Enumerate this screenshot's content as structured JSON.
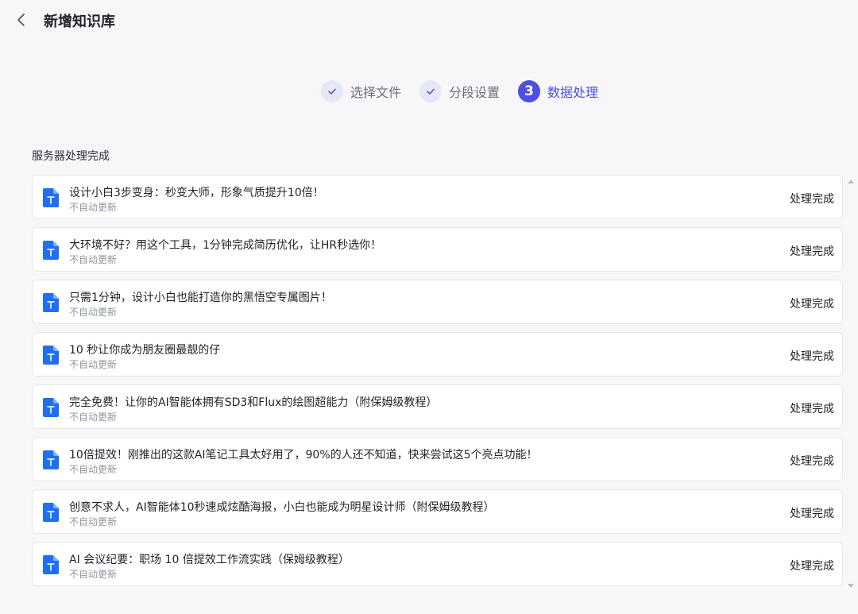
{
  "header": {
    "title": "新增知识库"
  },
  "steps": [
    {
      "label": "选择文件",
      "state": "done"
    },
    {
      "label": "分段设置",
      "state": "done"
    },
    {
      "number": "3",
      "label": "数据处理",
      "state": "active"
    }
  ],
  "section": {
    "title": "服务器处理完成"
  },
  "items": [
    {
      "title": "设计小白3步变身：秒变大师，形象气质提升10倍！",
      "subtitle": "不自动更新",
      "status": "处理完成"
    },
    {
      "title": "大环境不好？用这个工具，1分钟完成简历优化，让HR秒选你！",
      "subtitle": "不自动更新",
      "status": "处理完成"
    },
    {
      "title": "只需1分钟，设计小白也能打造你的黑悟空专属图片！",
      "subtitle": "不自动更新",
      "status": "处理完成"
    },
    {
      "title": "10 秒让你成为朋友圈最靓的仔",
      "subtitle": "不自动更新",
      "status": "处理完成"
    },
    {
      "title": "完全免费！让你的AI智能体拥有SD3和Flux的绘图超能力（附保姆级教程）",
      "subtitle": "不自动更新",
      "status": "处理完成"
    },
    {
      "title": "10倍提效！刚推出的这款AI笔记工具太好用了，90%的人还不知道，快来尝试这5个亮点功能！",
      "subtitle": "不自动更新",
      "status": "处理完成"
    },
    {
      "title": "创意不求人，AI智能体10秒速成炫酷海报，小白也能成为明星设计师（附保姆级教程）",
      "subtitle": "不自动更新",
      "status": "处理完成"
    },
    {
      "title": "AI 会议纪要：职场 10 倍提效工作流实践（保姆级教程）",
      "subtitle": "不自动更新",
      "status": "处理完成"
    }
  ],
  "icons": {
    "back": "chevron-left-icon",
    "step_done": "check-icon",
    "file": "text-document-icon"
  },
  "colors": {
    "accent": "#4e4fe0",
    "file_icon": "#1f6ff5",
    "step_done_bg": "#e6e8f7"
  }
}
